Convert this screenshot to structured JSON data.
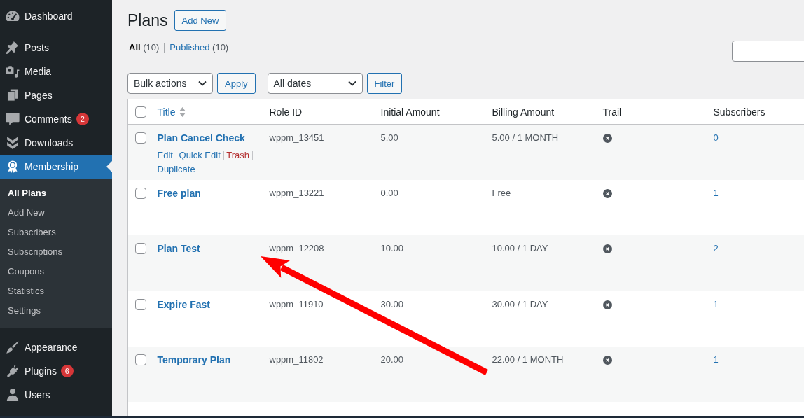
{
  "sidebar": {
    "sections": [
      {
        "items": [
          {
            "label": "Dashboard",
            "selected": false
          }
        ]
      },
      {
        "items": [
          {
            "label": "Posts",
            "selected": false
          },
          {
            "label": "Media",
            "selected": false
          },
          {
            "label": "Pages",
            "selected": false
          },
          {
            "label": "Comments",
            "selected": false,
            "badge": "2"
          },
          {
            "label": "Downloads",
            "selected": false
          },
          {
            "label": "Membership",
            "selected": true,
            "children": [
              {
                "label": "All Plans",
                "selected": true
              },
              {
                "label": "Add New",
                "selected": false
              },
              {
                "label": "Subscribers",
                "selected": false
              },
              {
                "label": "Subscriptions",
                "selected": false
              },
              {
                "label": "Coupons",
                "selected": false
              },
              {
                "label": "Statistics",
                "selected": false
              },
              {
                "label": "Settings",
                "selected": false
              }
            ]
          }
        ]
      },
      {
        "items": [
          {
            "label": "Appearance",
            "selected": false
          },
          {
            "label": "Plugins",
            "selected": false,
            "badge": "6"
          },
          {
            "label": "Users",
            "selected": false
          }
        ]
      }
    ]
  },
  "page": {
    "title": "Plans",
    "add_new_button": "Add New"
  },
  "views": [
    {
      "label": "All",
      "count": "(10)",
      "selected": true
    },
    {
      "label": "Published",
      "count": "(10)",
      "selected": false
    }
  ],
  "bulk_actions": {
    "select": "Bulk actions",
    "button": "Apply"
  },
  "date_filter": {
    "select": "All dates",
    "button": "Filter"
  },
  "table": {
    "select_all_checked": false,
    "columns": [
      {
        "label": "Title",
        "sortable": true
      },
      {
        "label": "Role ID",
        "sortable": false
      },
      {
        "label": "Initial Amount",
        "sortable": false
      },
      {
        "label": "Billing Amount",
        "sortable": false
      },
      {
        "label": "Trail",
        "sortable": false
      },
      {
        "label": "Subscribers",
        "sortable": false
      }
    ],
    "rows": [
      {
        "checked": false,
        "title": "Plan Cancel Check",
        "actions": [
          {
            "label": "Edit",
            "kind": "link"
          },
          {
            "label": "Quick Edit",
            "kind": "link"
          },
          {
            "label": "Trash",
            "kind": "delete"
          },
          {
            "label": "Duplicate",
            "kind": "link"
          }
        ],
        "role_id": "wppm_13451",
        "initial_amount": "5.00",
        "billing_amount": "5.00 / 1 MONTH",
        "trail": false,
        "subscribers": "0"
      },
      {
        "checked": false,
        "title": "Free plan",
        "role_id": "wppm_13221",
        "initial_amount": "0.00",
        "billing_amount": "Free",
        "trail": false,
        "subscribers": "1"
      },
      {
        "checked": false,
        "title": "Plan Test",
        "role_id": "wppm_12208",
        "initial_amount": "10.00",
        "billing_amount": "10.00 / 1 DAY",
        "trail": false,
        "subscribers": "2"
      },
      {
        "checked": false,
        "title": "Expire Fast",
        "role_id": "wppm_11910",
        "initial_amount": "30.00",
        "billing_amount": "30.00 / 1 DAY",
        "trail": false,
        "subscribers": "1"
      },
      {
        "checked": false,
        "title": "Temporary Plan",
        "role_id": "wppm_11802",
        "initial_amount": "20.00",
        "billing_amount": "22.00 / 1 MONTH",
        "trail": false,
        "subscribers": "1"
      }
    ]
  },
  "annotation": {
    "kind": "arrow"
  }
}
